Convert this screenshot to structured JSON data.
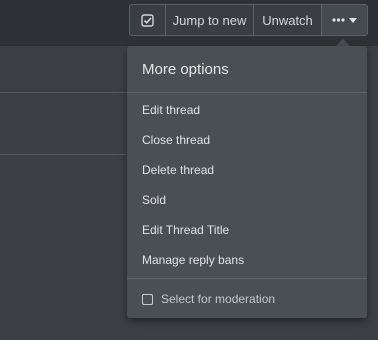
{
  "toolbar": {
    "select_icon": "checkbox-check-icon",
    "jump_label": "Jump to new",
    "unwatch_label": "Unwatch",
    "more_icon": "ellipsis-icon",
    "caret_icon": "caret-down-icon"
  },
  "menu": {
    "title": "More options",
    "items": [
      {
        "label": "Edit thread"
      },
      {
        "label": "Close thread"
      },
      {
        "label": "Delete thread"
      },
      {
        "label": "Sold"
      },
      {
        "label": "Edit Thread Title"
      },
      {
        "label": "Manage reply bans"
      }
    ],
    "moderation_label": "Select for moderation"
  }
}
